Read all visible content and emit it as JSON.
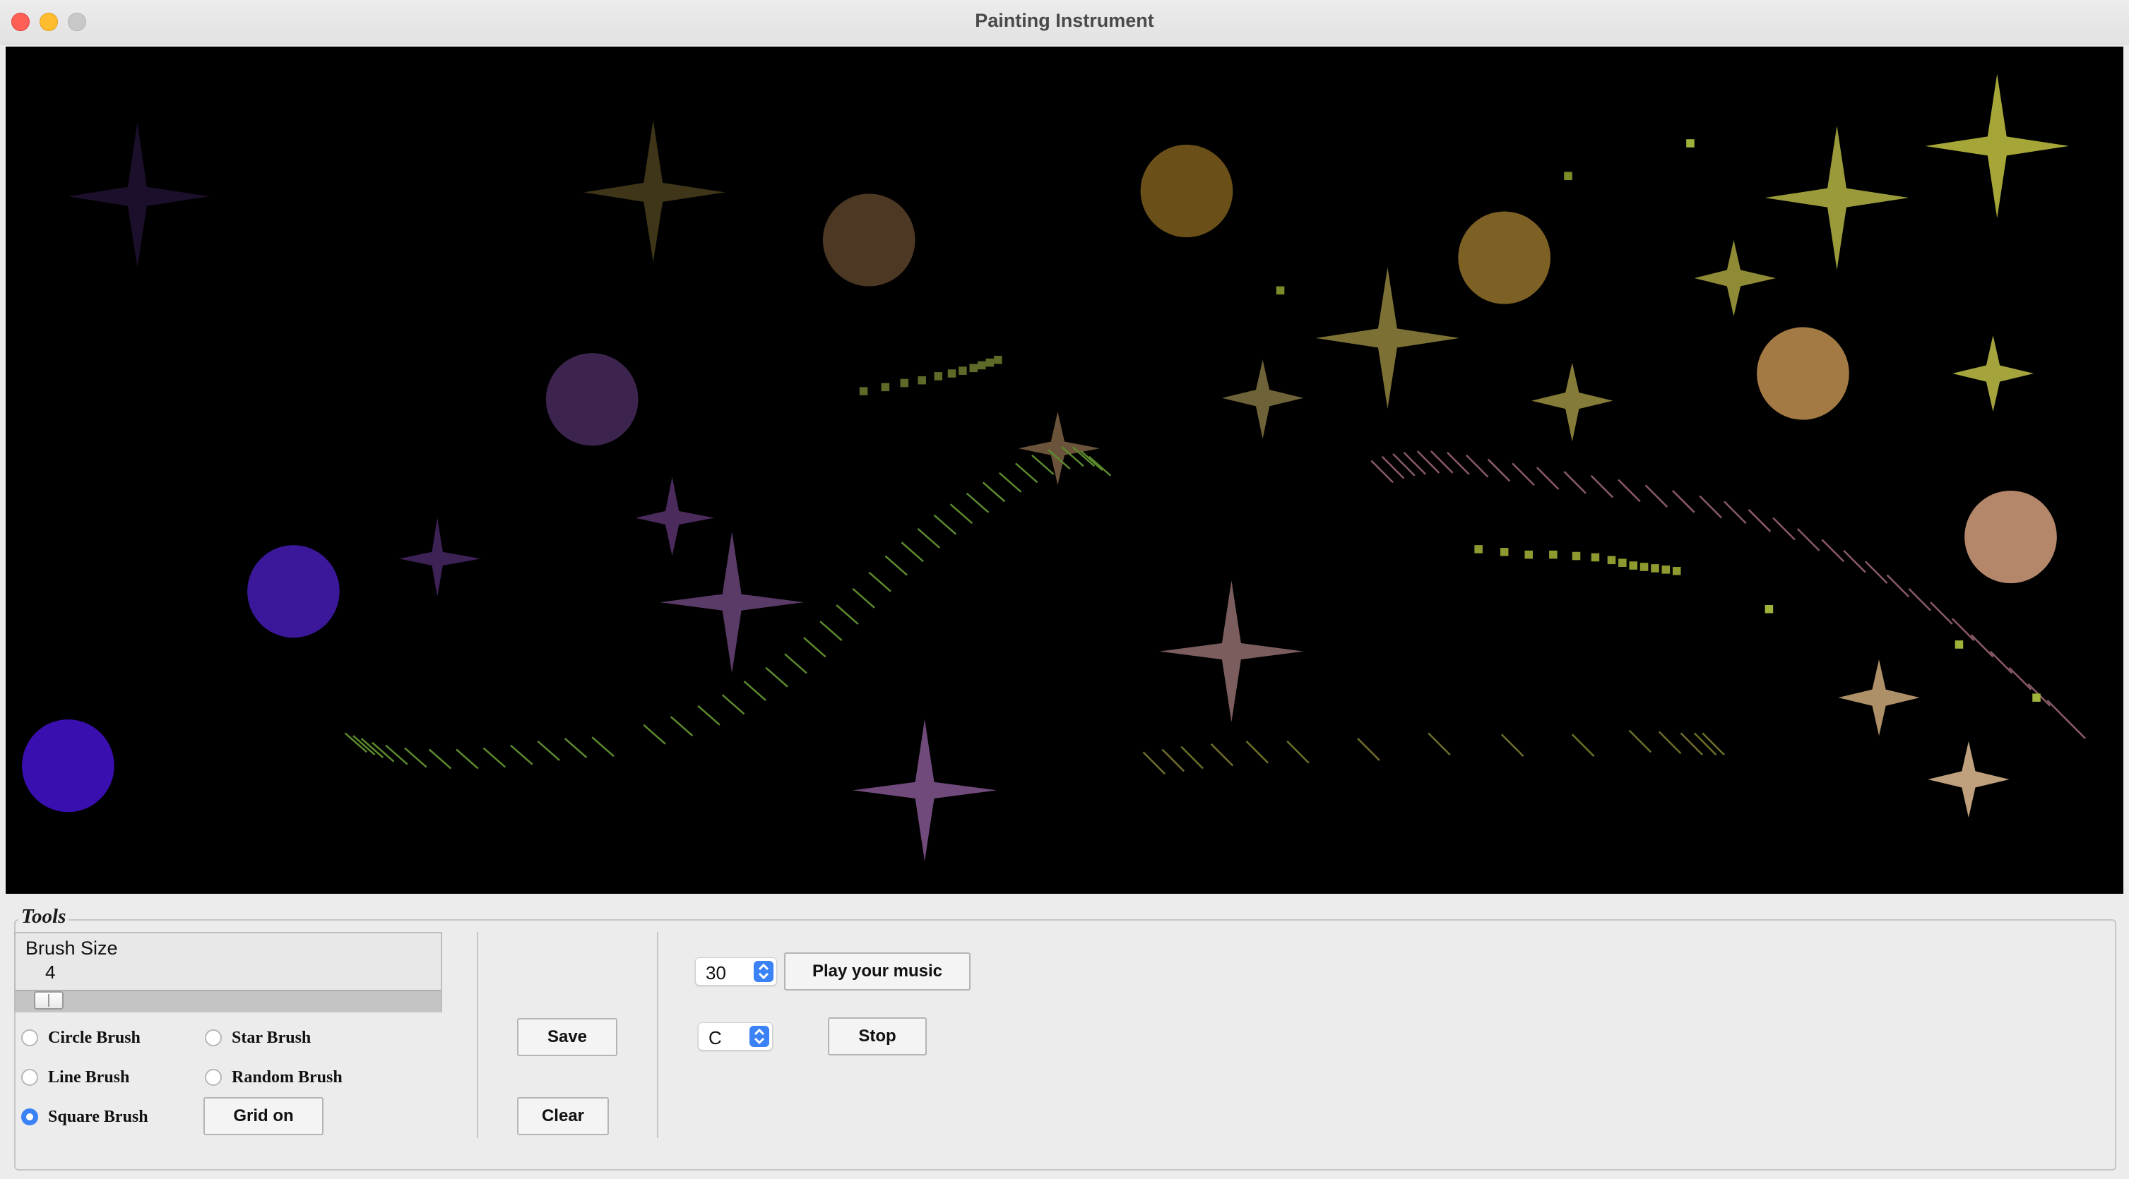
{
  "window": {
    "title": "Painting Instrument"
  },
  "tools": {
    "group_label": "Tools",
    "brush_size": {
      "label": "Brush Size",
      "value": "4"
    },
    "brushes": [
      {
        "label": "Circle Brush",
        "selected": false
      },
      {
        "label": "Star Brush",
        "selected": false
      },
      {
        "label": "Line Brush",
        "selected": false
      },
      {
        "label": "Random Brush",
        "selected": false
      },
      {
        "label": "Square Brush",
        "selected": true
      }
    ],
    "grid_button": "Grid on",
    "save_button": "Save",
    "clear_button": "Clear",
    "tempo": {
      "value": "30"
    },
    "key": {
      "value": "C"
    },
    "play_button": "Play your music",
    "stop_button": "Stop"
  },
  "colors": {
    "canvas_bg": "#000000",
    "accent": "#3b82f6"
  }
}
